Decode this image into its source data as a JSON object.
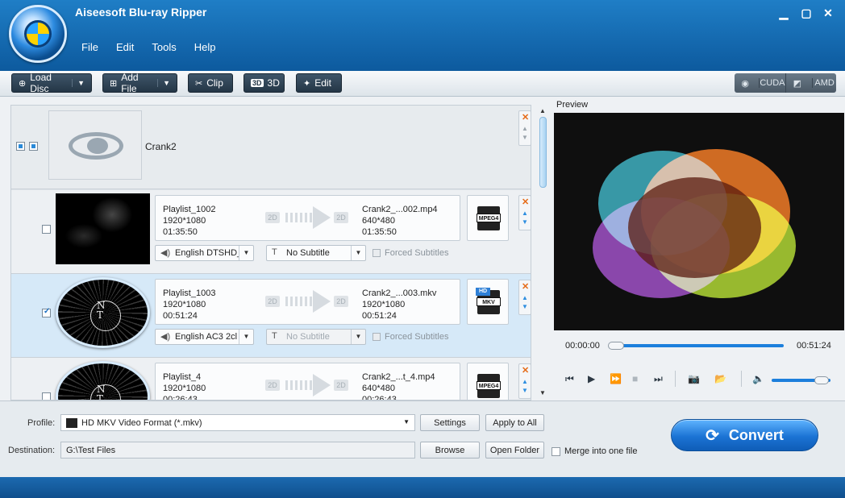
{
  "app": {
    "title": "Aiseesoft Blu-ray Ripper"
  },
  "menu": [
    "File",
    "Edit",
    "Tools",
    "Help"
  ],
  "window_controls": {
    "minimize": "▁",
    "maximize": "▢",
    "close": "✕"
  },
  "toolbar": {
    "load_disc": "Load Disc",
    "add_file": "Add File",
    "clip": "Clip",
    "three_d": "3D",
    "edit": "Edit",
    "cuda": "CUDA",
    "amd": "AMD"
  },
  "disc": {
    "name": "Crank2"
  },
  "items": [
    {
      "src_title": "Playlist_1002",
      "src_res": "1920*1080",
      "src_dur": "01:35:50",
      "dst_title": "Crank2_...002.mp4",
      "dst_res": "640*480",
      "dst_dur": "01:35:50",
      "audio": "English DTSHD_",
      "subtitle": "No Subtitle",
      "forced": "Forced Subtitles",
      "format": "MPEG4",
      "checked": false
    },
    {
      "src_title": "Playlist_1003",
      "src_res": "1920*1080",
      "src_dur": "00:51:24",
      "dst_title": "Crank2_...003.mkv",
      "dst_res": "1920*1080",
      "dst_dur": "00:51:24",
      "audio": "English AC3 2cl",
      "subtitle": "No Subtitle",
      "forced": "Forced Subtitles",
      "format": "MKV",
      "format_badge": "HD",
      "checked": true
    },
    {
      "src_title": "Playlist_4",
      "src_res": "1920*1080",
      "src_dur": "00:26:43",
      "dst_title": "Crank2_...t_4.mp4",
      "dst_res": "640*480",
      "dst_dur": "00:26:43",
      "format": "MPEG4",
      "checked": false
    }
  ],
  "badge_2d": "2D",
  "preview": {
    "label": "Preview",
    "time_current": "00:00:00",
    "time_total": "00:51:24",
    "seek_progress": 0.0,
    "volume": 0.8
  },
  "bottom": {
    "profile_label": "Profile:",
    "profile_value": "HD MKV Video Format (*.mkv)",
    "settings": "Settings",
    "apply_to_all": "Apply to All",
    "destination_label": "Destination:",
    "destination_value": "G:\\Test Files",
    "browse": "Browse",
    "open_folder": "Open Folder",
    "merge": "Merge into one file",
    "convert": "Convert"
  },
  "colors": {
    "accent": "#1b73d4",
    "header": "#1f7ec6"
  }
}
